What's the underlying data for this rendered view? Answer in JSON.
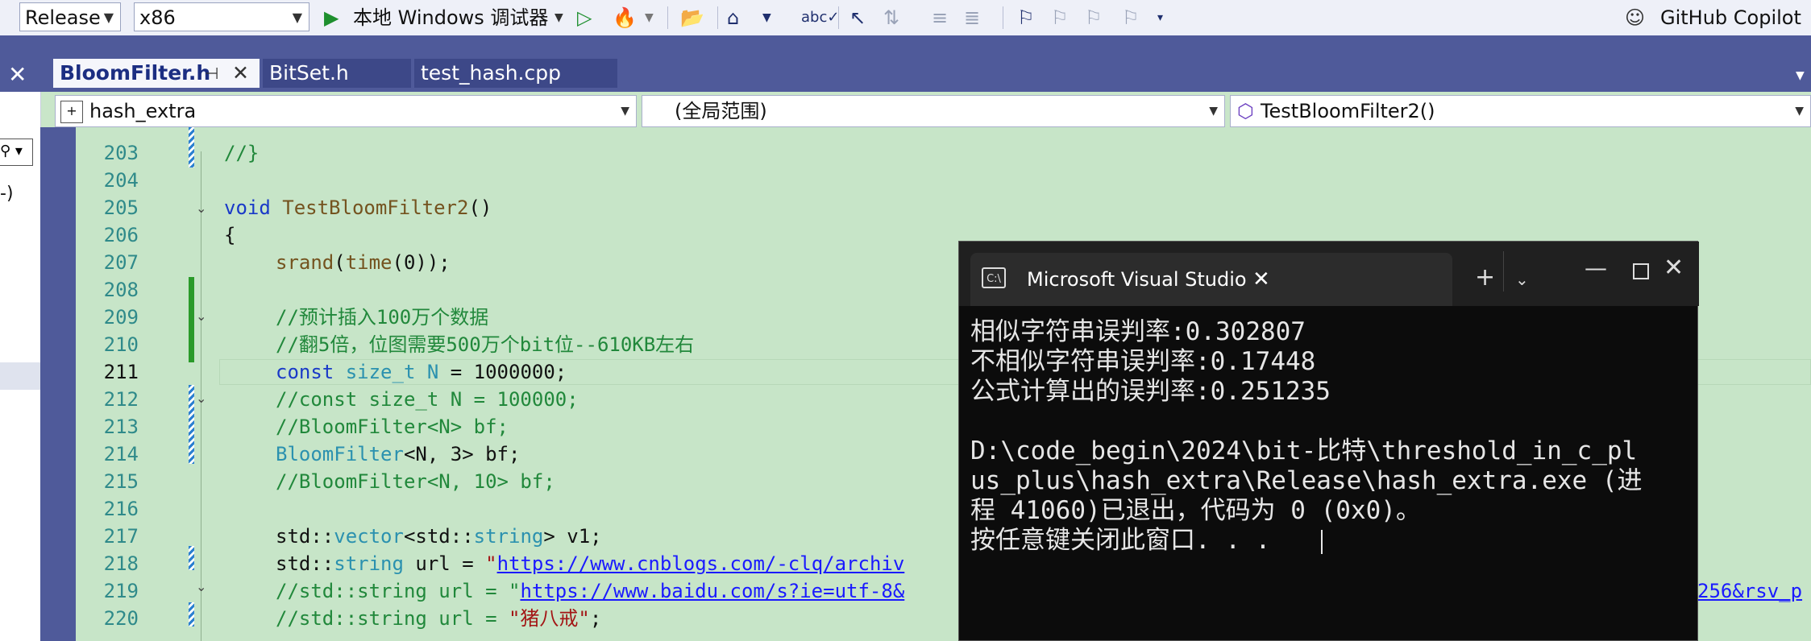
{
  "toolbar": {
    "config": "Release",
    "platform": "x86",
    "debugger_label": "本地 Windows 调试器",
    "copilot_label": "GitHub Copilot"
  },
  "tabs": [
    {
      "label": "BloomFilter.h",
      "active": true
    },
    {
      "label": "BitSet.h",
      "active": false
    },
    {
      "label": "test_hash.cpp",
      "active": false
    }
  ],
  "nav": {
    "project": "hash_extra",
    "scope": "(全局范围)",
    "member": "TestBloomFilter2()"
  },
  "editor": {
    "line_numbers": [
      "203",
      "204",
      "205",
      "206",
      "207",
      "208",
      "209",
      "210",
      "211",
      "212",
      "213",
      "214",
      "215",
      "216",
      "217",
      "218",
      "219",
      "220"
    ],
    "current_line": "211",
    "lines": {
      "l203": "//}",
      "l205_kw": "void",
      "l205_fn": "TestBloomFilter2",
      "l205_rest": "()",
      "l206": "{",
      "l207_fn": "srand",
      "l207_a": "(",
      "l207_fn2": "time",
      "l207_b": "(0));",
      "l209": "//预计插入100万个数据",
      "l210": "//翻5倍，位图需要500万个bit位--610KB左右",
      "l211_kw": "const",
      "l211_ty": "size_t",
      "l211_n": "N",
      "l211_rest": " = 1000000;",
      "l212": "//const size_t N = 100000;",
      "l213": "//BloomFilter<N> bf;",
      "l214_ty": "BloomFilter",
      "l214_rest": "<N, 3> bf;",
      "l215": "//BloomFilter<N, 10> bf;",
      "l217_a": "std::",
      "l217_ty": "vector",
      "l217_b": "<std::",
      "l217_ty2": "string",
      "l217_c": "> v1;",
      "l218_a": "std::",
      "l218_ty": "string",
      "l218_b": " url = ",
      "l218_q": "\"",
      "l218_link": "https://www.cnblogs.com/-clq/archiv",
      "l219_a": "//std::string url = \"",
      "l219_link": "https://www.baidu.com/s?ie=utf-8&",
      "l219_tail": "256&rsv_p",
      "l220_a": "//std::string url = ",
      "l220_s": "\"猪八戒\"",
      "l220_b": ";"
    }
  },
  "console": {
    "title": "Microsoft Visual Studio",
    "lines": [
      "相似字符串误判率:0.302807",
      "不相似字符串误判率:0.17448",
      "公式计算出的误判率:0.251235",
      "",
      "D:\\code_begin\\2024\\bit-比特\\threshold_in_c_pl",
      "us_plus\\hash_extra\\Release\\hash_extra.exe (进",
      "程 41060)已退出，代码为 0 (0x0)。",
      "按任意键关闭此窗口. . ."
    ]
  }
}
